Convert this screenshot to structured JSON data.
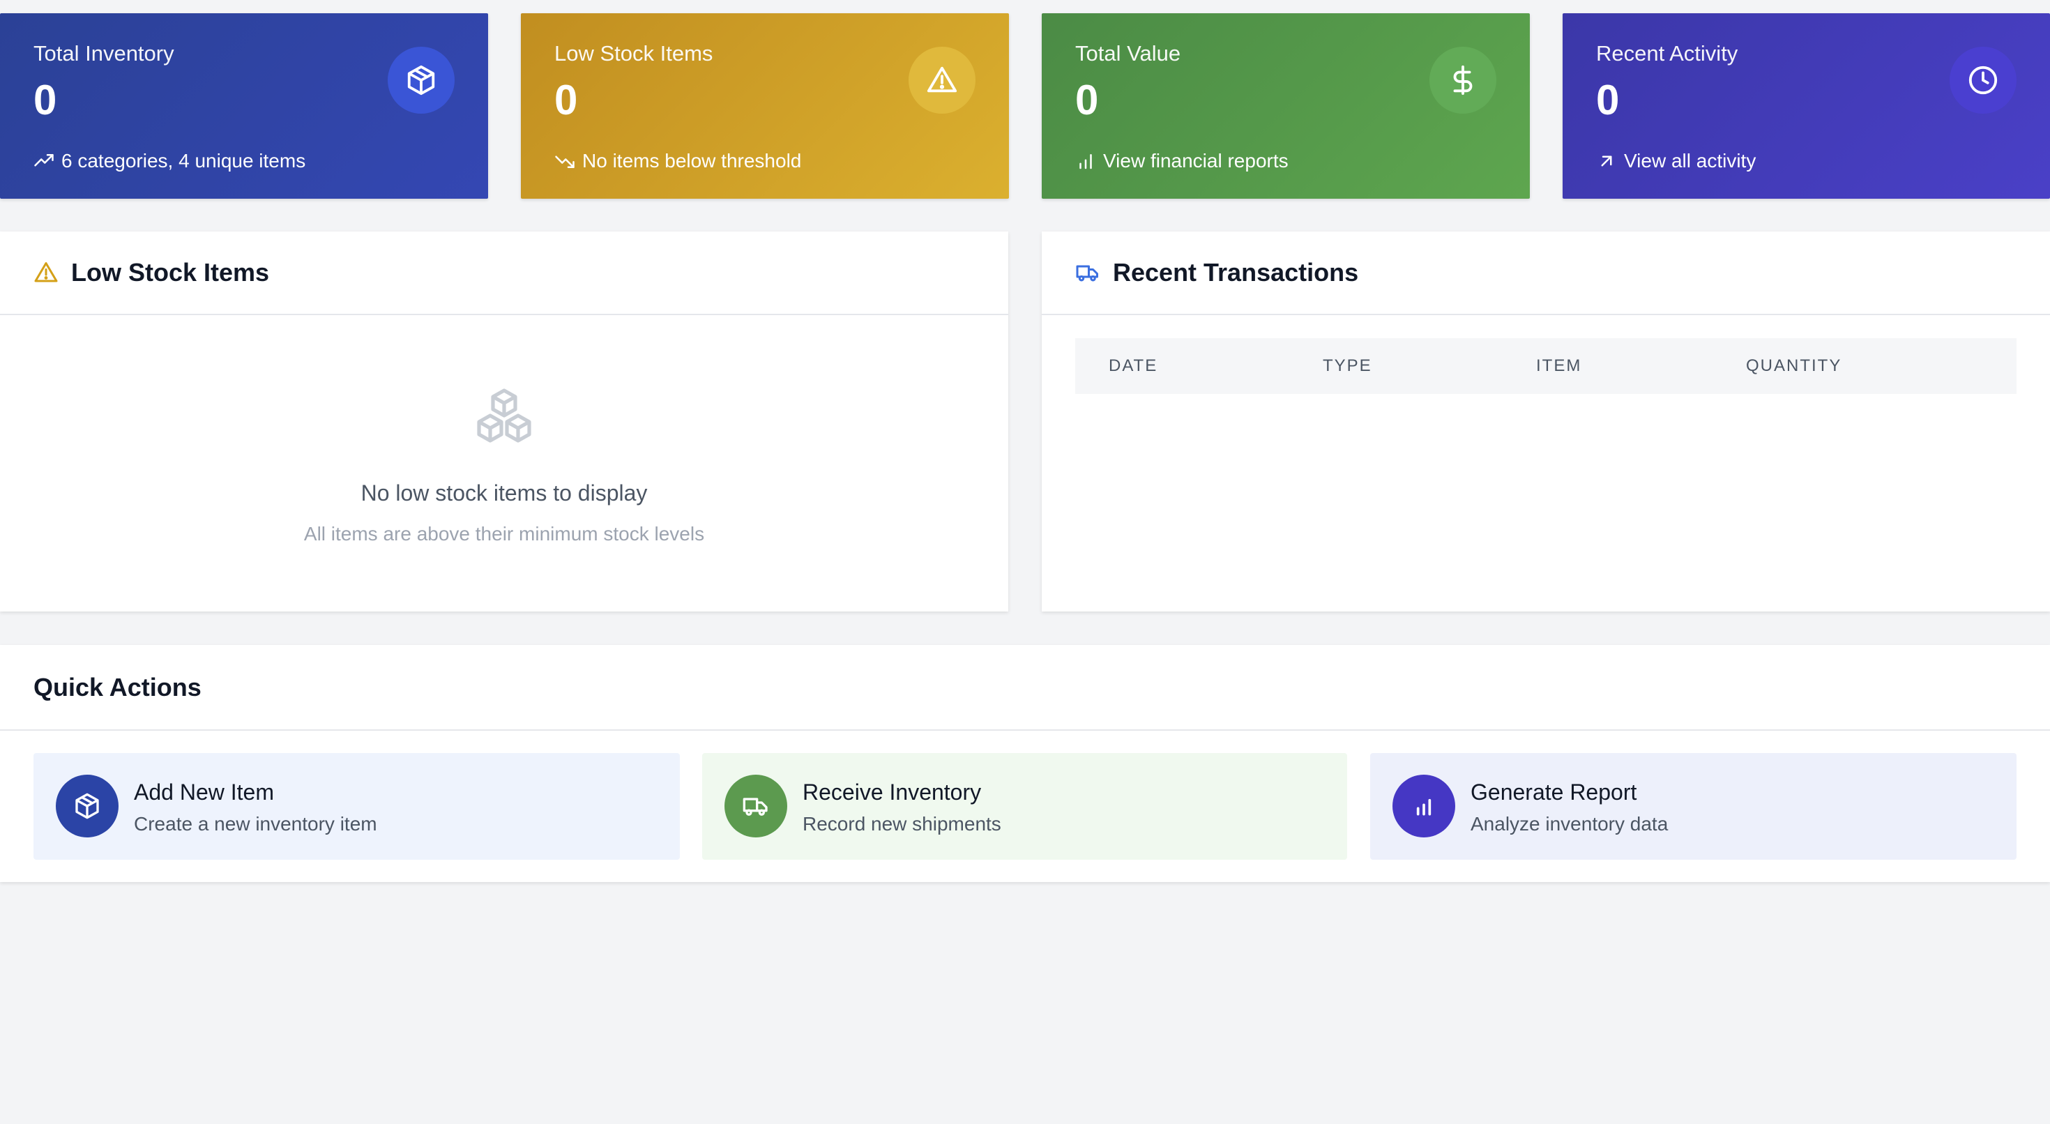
{
  "stats": [
    {
      "title": "Total Inventory",
      "value": "0",
      "footer": "6 categories, 4 unique items",
      "icon": "box-icon",
      "foot_icon": "trending-up-icon"
    },
    {
      "title": "Low Stock Items",
      "value": "0",
      "footer": "No items below threshold",
      "icon": "alert-triangle-icon",
      "foot_icon": "trending-down-icon"
    },
    {
      "title": "Total Value",
      "value": "0",
      "footer": "View financial reports",
      "icon": "dollar-icon",
      "foot_icon": "bar-chart-icon"
    },
    {
      "title": "Recent Activity",
      "value": "0",
      "footer": "View all activity",
      "icon": "clock-icon",
      "foot_icon": "arrow-up-right-icon"
    }
  ],
  "low_stock": {
    "title": "Low Stock Items",
    "empty_title": "No low stock items to display",
    "empty_subtitle": "All items are above their minimum stock levels"
  },
  "transactions": {
    "title": "Recent Transactions",
    "columns": [
      "DATE",
      "TYPE",
      "ITEM",
      "QUANTITY"
    ]
  },
  "quick_actions": {
    "title": "Quick Actions",
    "items": [
      {
        "title": "Add New Item",
        "subtitle": "Create a new inventory item",
        "icon": "box-icon"
      },
      {
        "title": "Receive Inventory",
        "subtitle": "Record new shipments",
        "icon": "truck-icon"
      },
      {
        "title": "Generate Report",
        "subtitle": "Analyze inventory data",
        "icon": "bar-chart-icon"
      }
    ]
  },
  "colors": {
    "blue": "#2b4196",
    "yellow": "#c18e20",
    "green": "#4b8b45",
    "indigo": "#3b37a8",
    "warning_icon": "#d4a017",
    "truck_icon": "#3b6fe0"
  }
}
